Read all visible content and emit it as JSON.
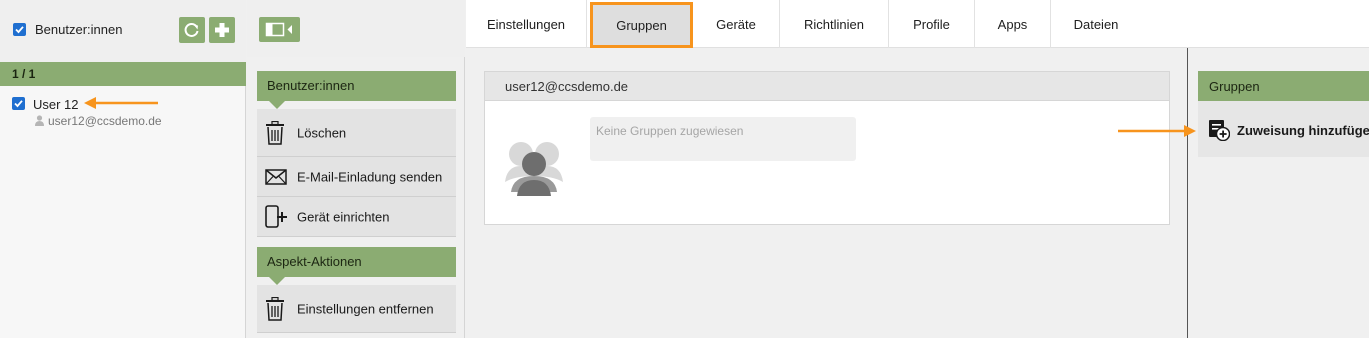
{
  "users": {
    "title": "Benutzer:innen",
    "count": "1 / 1",
    "items": [
      {
        "name": "User 12",
        "email": "user12@ccsdemo.de"
      }
    ]
  },
  "actions": {
    "sections": [
      {
        "title": "Benutzer:innen",
        "items": [
          {
            "label": "Löschen",
            "icon": "trash-icon"
          },
          {
            "label": "E-Mail-Einladung senden",
            "icon": "envelope-icon"
          },
          {
            "label": "Gerät einrichten",
            "icon": "add-device-icon"
          }
        ]
      },
      {
        "title": "Aspekt-Aktionen",
        "items": [
          {
            "label": "Einstellungen entfernen",
            "icon": "trash-icon"
          }
        ]
      }
    ]
  },
  "tabs": [
    {
      "label": "Einstellungen"
    },
    {
      "label": "Gruppen",
      "active": true
    },
    {
      "label": "Geräte"
    },
    {
      "label": "Richtlinien"
    },
    {
      "label": "Profile"
    },
    {
      "label": "Apps"
    },
    {
      "label": "Dateien"
    }
  ],
  "detail": {
    "user_email": "user12@ccsdemo.de",
    "empty_groups_text": "Keine Gruppen zugewiesen"
  },
  "groups_panel": {
    "title": "Gruppen",
    "assign_label": "Zuweisung hinzufügen"
  },
  "colors": {
    "accent_green": "#8bac72",
    "highlight_orange": "#f7941d",
    "checkbox_blue": "#1f6fd0"
  }
}
